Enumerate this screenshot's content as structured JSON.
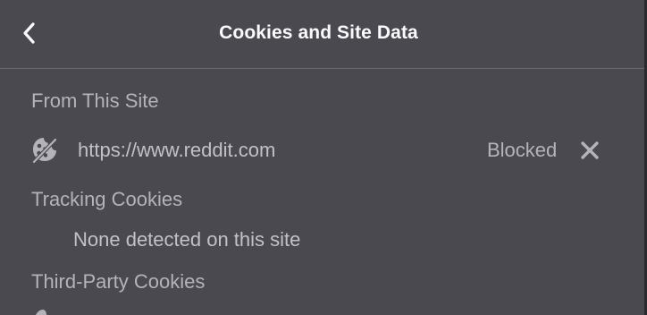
{
  "header": {
    "title": "Cookies and Site Data",
    "back_icon": "chevron-left-icon"
  },
  "sections": {
    "from_this_site": {
      "label": "From This Site",
      "entries": [
        {
          "icon": "cookie-blocked-icon",
          "url": "https://www.reddit.com",
          "status": "Blocked",
          "remove_icon": "close-icon"
        }
      ]
    },
    "tracking_cookies": {
      "label": "Tracking Cookies",
      "empty_text": "None detected on this site"
    },
    "third_party_cookies": {
      "label": "Third-Party Cookies"
    }
  },
  "colors": {
    "background": "#4a494f",
    "title": "#fbfbfe",
    "section_label": "#b4b3b9",
    "text": "#c2c1c7",
    "divider": "#6a696f"
  }
}
